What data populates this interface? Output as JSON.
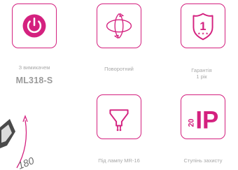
{
  "features": [
    {
      "caption_lines": [
        "З вимикачем"
      ],
      "icon": "power-icon"
    },
    {
      "caption_lines": [
        "Поворотний"
      ],
      "icon": "rotate-icon"
    },
    {
      "caption_lines": [
        "Гарантія",
        "1 рік"
      ],
      "icon": "warranty-shield-icon",
      "warranty_digit": "1"
    },
    {
      "caption_lines": [
        "Під лампу MR-16"
      ],
      "icon": "mr16-lamp-icon"
    },
    {
      "caption_lines": [
        "Ступінь захисту"
      ],
      "icon": "ip-rating-icon",
      "ip_text": "IP",
      "ip_number": "20"
    }
  ],
  "model": "ML318-S",
  "corner_graphic": {
    "text": "180"
  },
  "colors": {
    "accent": "#d4217f",
    "caption": "#a8a8a8",
    "model": "#9a9a9a"
  }
}
